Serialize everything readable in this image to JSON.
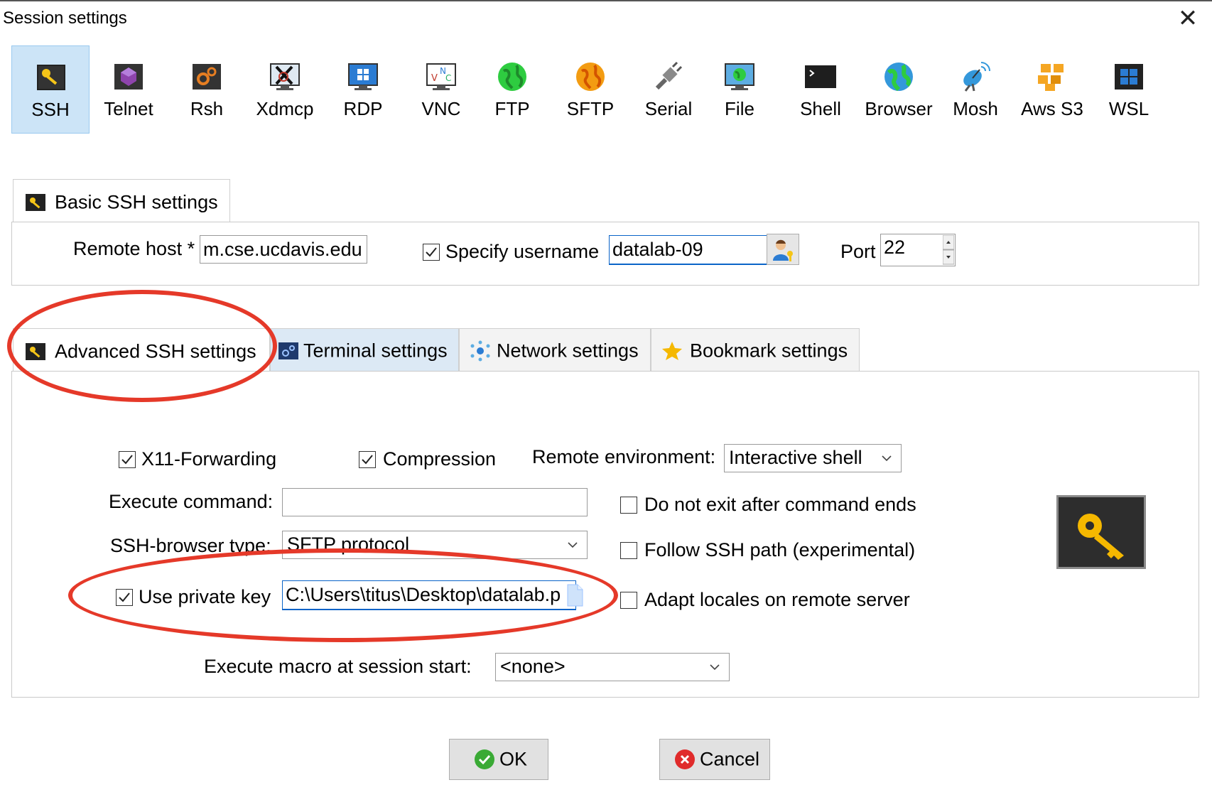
{
  "window": {
    "title": "Session settings",
    "close_glyph": "✕"
  },
  "protocols": [
    {
      "label": "SSH",
      "icon": "ssh-key-icon",
      "selected": true
    },
    {
      "label": "Telnet",
      "icon": "telnet-gem-icon"
    },
    {
      "label": "Rsh",
      "icon": "rsh-gears-icon"
    },
    {
      "label": "Xdmcp",
      "icon": "xdmcp-x-icon"
    },
    {
      "label": "RDP",
      "icon": "rdp-monitor-icon"
    },
    {
      "label": "VNC",
      "icon": "vnc-monitor-icon"
    },
    {
      "label": "FTP",
      "icon": "ftp-globe-icon"
    },
    {
      "label": "SFTP",
      "icon": "sftp-globe-icon"
    },
    {
      "label": "Serial",
      "icon": "serial-plug-icon"
    },
    {
      "label": "File",
      "icon": "file-monitor-icon"
    },
    {
      "label": "Shell",
      "icon": "shell-terminal-icon"
    },
    {
      "label": "Browser",
      "icon": "browser-globe-icon"
    },
    {
      "label": "Mosh",
      "icon": "mosh-satellite-icon"
    },
    {
      "label": "Aws S3",
      "icon": "aws-s3-cubes-icon"
    },
    {
      "label": "WSL",
      "icon": "wsl-windows-icon"
    }
  ],
  "basic": {
    "tab_label": "Basic SSH settings",
    "remote_host_label": "Remote host *",
    "remote_host_value": "m.cse.ucdavis.edu",
    "specify_username_label": "Specify username",
    "specify_username_checked": true,
    "username_value": "datalab-09",
    "user_button_icon": "user-key-icon",
    "port_label": "Port",
    "port_value": "22"
  },
  "advanced_tabs": [
    {
      "label": "Advanced SSH settings",
      "icon": "key-icon",
      "active": true
    },
    {
      "label": "Terminal settings",
      "icon": "terminal-gears-icon"
    },
    {
      "label": "Network settings",
      "icon": "network-dots-icon"
    },
    {
      "label": "Bookmark settings",
      "icon": "star-icon"
    }
  ],
  "advanced": {
    "x11_label": "X11-Forwarding",
    "x11_checked": true,
    "compression_label": "Compression",
    "compression_checked": true,
    "remote_env_label": "Remote environment:",
    "remote_env_value": "Interactive shell",
    "exec_cmd_label": "Execute command:",
    "exec_cmd_value": "",
    "do_not_exit_label": "Do not exit after command ends",
    "browser_type_label": "SSH-browser type:",
    "browser_type_value": "SFTP protocol",
    "follow_path_label": "Follow SSH path (experimental)",
    "private_key_label": "Use private key",
    "private_key_checked": true,
    "private_key_value": "C:\\Users\\titus\\Desktop\\datalab.p",
    "adapt_locales_label": "Adapt locales on remote server",
    "macro_label": "Execute macro at session start:",
    "macro_value": "<none>"
  },
  "buttons": {
    "ok_label": "OK",
    "cancel_label": "Cancel"
  },
  "colors": {
    "annotation": "#e53929",
    "selected_bg": "#cce4f7",
    "ok_green": "#3aaa35",
    "cancel_red": "#e02b2b"
  }
}
